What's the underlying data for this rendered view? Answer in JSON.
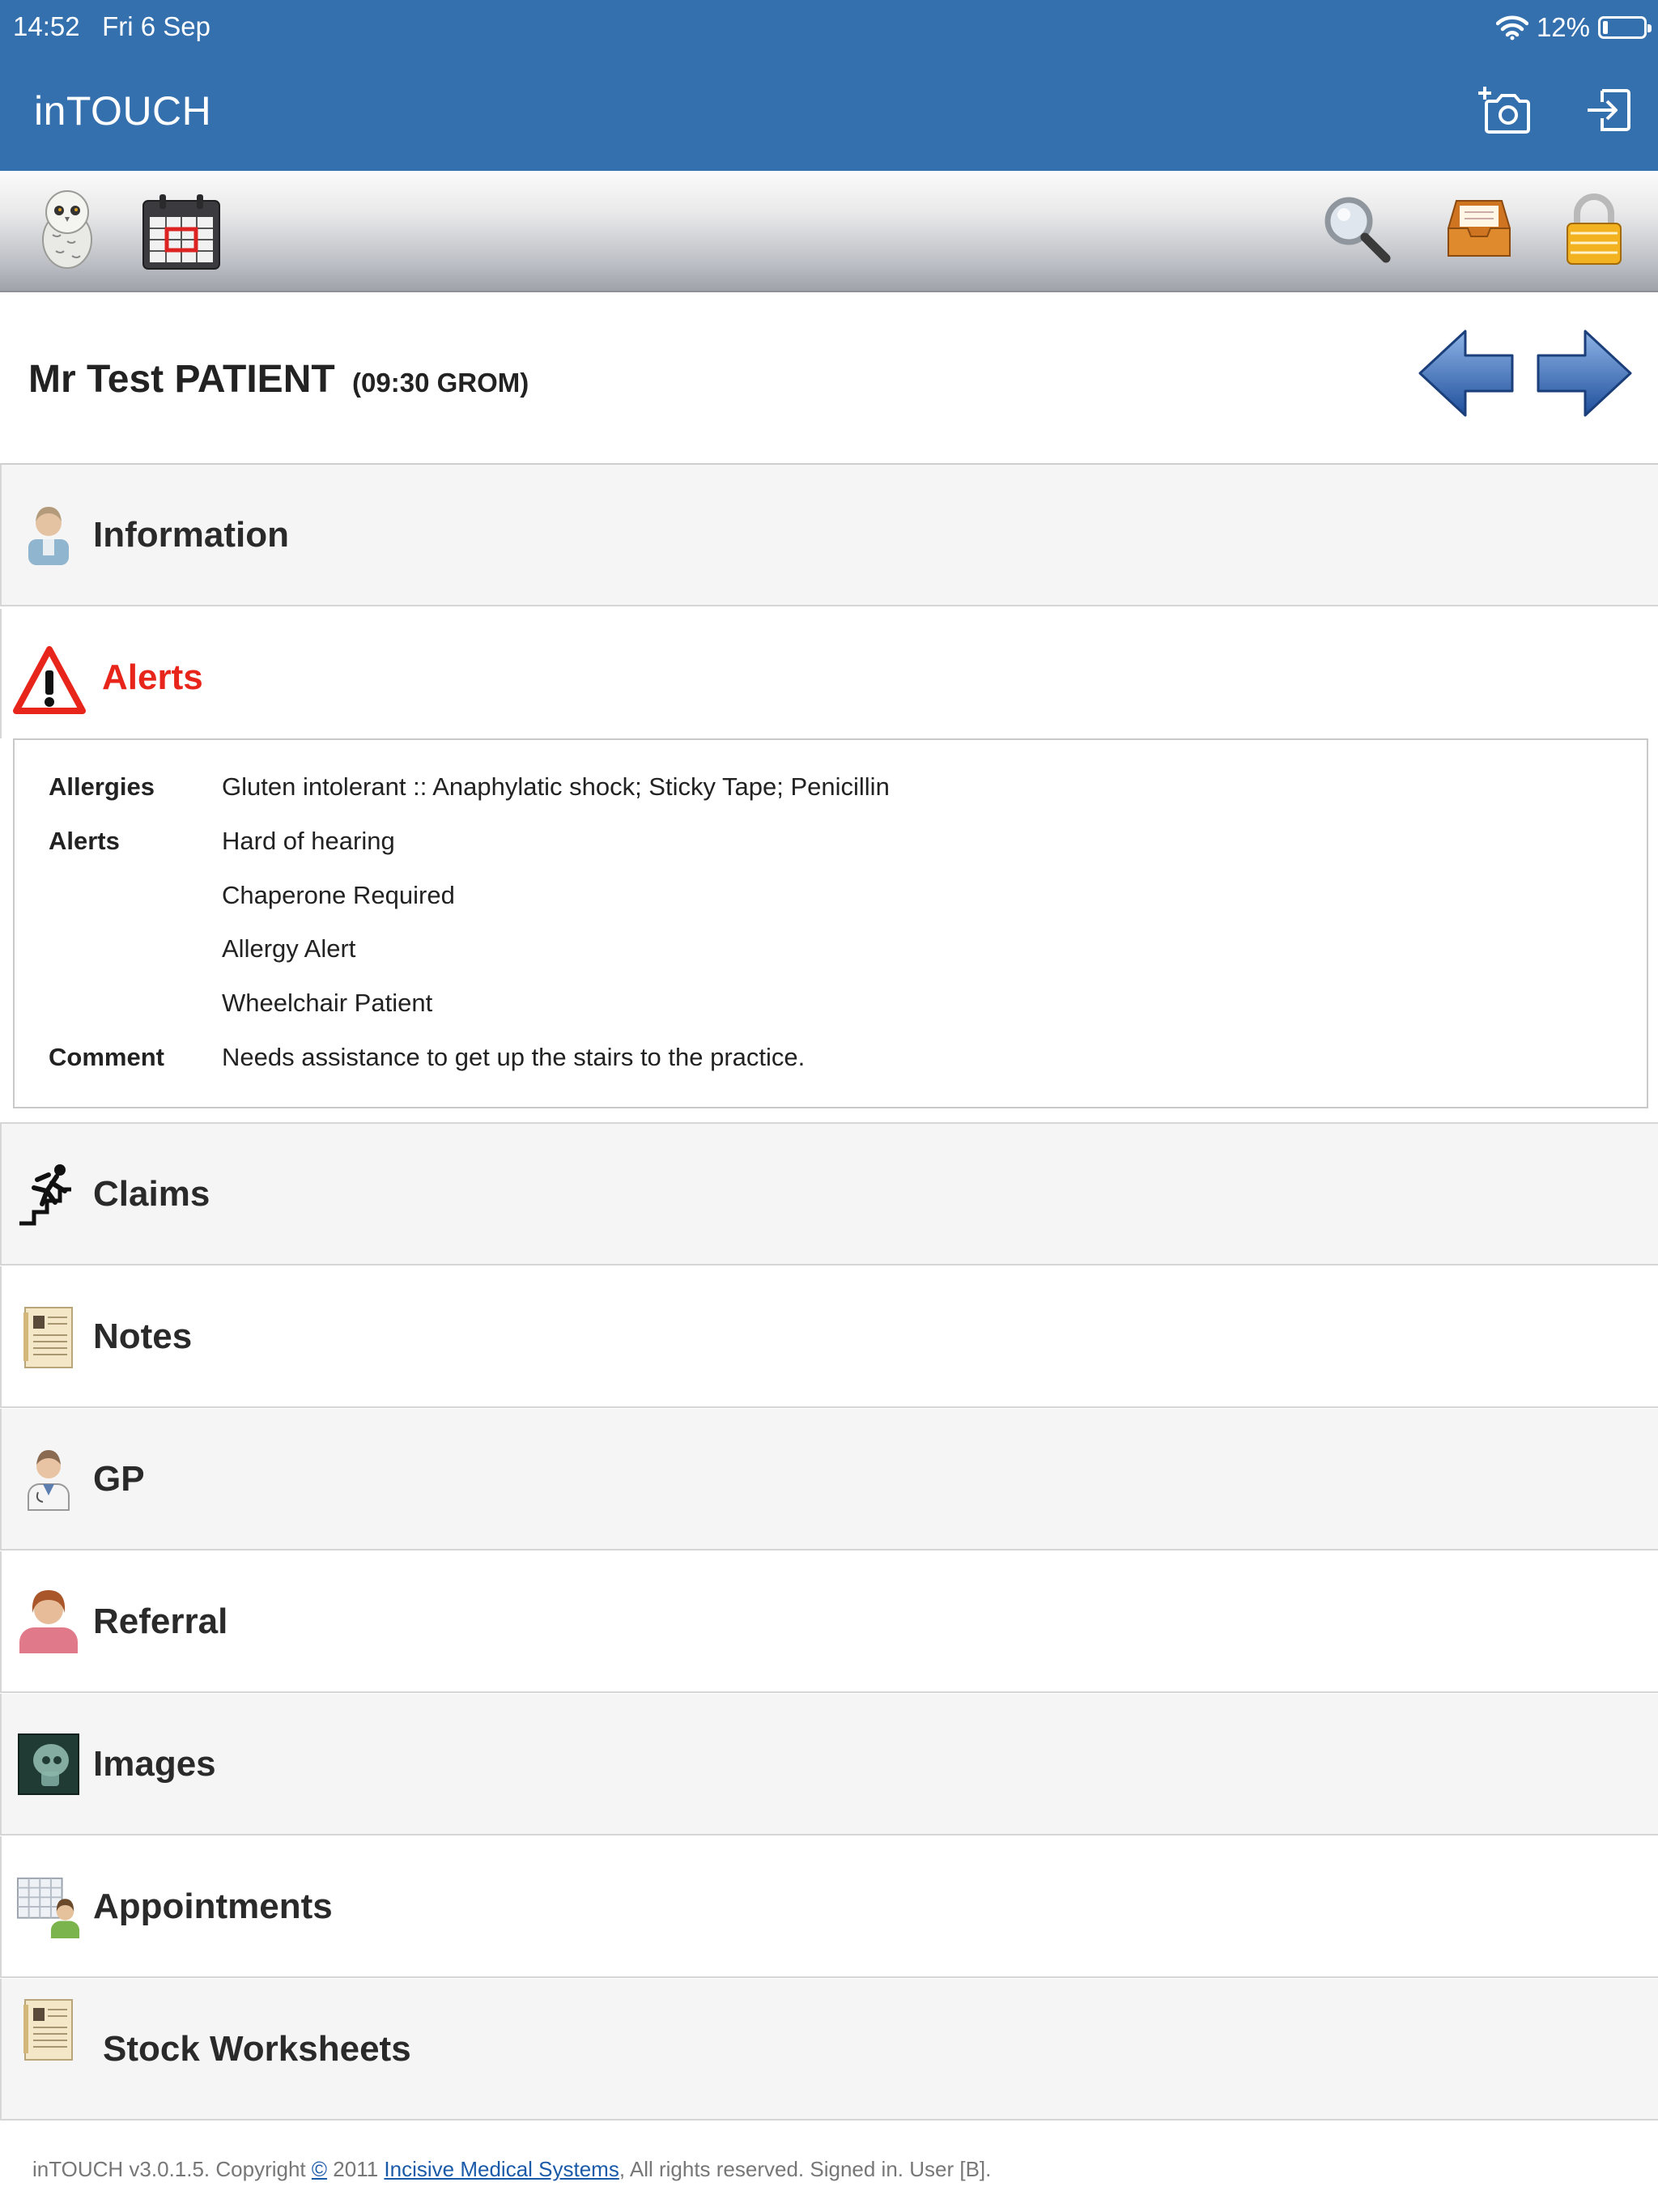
{
  "status": {
    "time": "14:52",
    "date": "Fri 6 Sep",
    "battery": "12%",
    "battery_level": 0.12
  },
  "app": {
    "title": "inTOUCH",
    "camera_icon": "add-photo-icon",
    "logout_icon": "logout-icon"
  },
  "toolbar": {
    "left": [
      {
        "icon": "owl-icon"
      },
      {
        "icon": "calendar-icon"
      }
    ],
    "right": [
      {
        "icon": "search-icon"
      },
      {
        "icon": "inbox-tray-icon"
      },
      {
        "icon": "padlock-icon"
      }
    ]
  },
  "patient": {
    "name": "Mr Test PATIENT",
    "appointment": "(09:30 GROM)"
  },
  "sections": {
    "information": "Information",
    "alerts": "Alerts",
    "claims": "Claims",
    "notes": "Notes",
    "gp": "GP",
    "referral": "Referral",
    "images": "Images",
    "appointments": "Appointments",
    "stock_worksheets": "Stock Worksheets"
  },
  "alerts_detail": {
    "allergies_label": "Allergies",
    "allergies": "Gluten intolerant :: Anaphylatic shock; Sticky Tape; Penicillin",
    "alerts_label": "Alerts",
    "alerts": [
      "Hard of hearing",
      "Chaperone Required",
      "Allergy Alert",
      "Wheelchair Patient"
    ],
    "comment_label": "Comment",
    "comment": "Needs assistance to get up the stairs to the practice."
  },
  "footer": {
    "prefix": "inTOUCH v3.0.1.5. Copyright ",
    "copyright_symbol": "©",
    "year": " 2011 ",
    "company": "Incisive Medical Systems",
    "suffix": ", All rights reserved. Signed in. User [B]."
  },
  "colors": {
    "appbar": "#346fae",
    "alert_red": "#e8251b",
    "link": "#1a5aa8"
  }
}
